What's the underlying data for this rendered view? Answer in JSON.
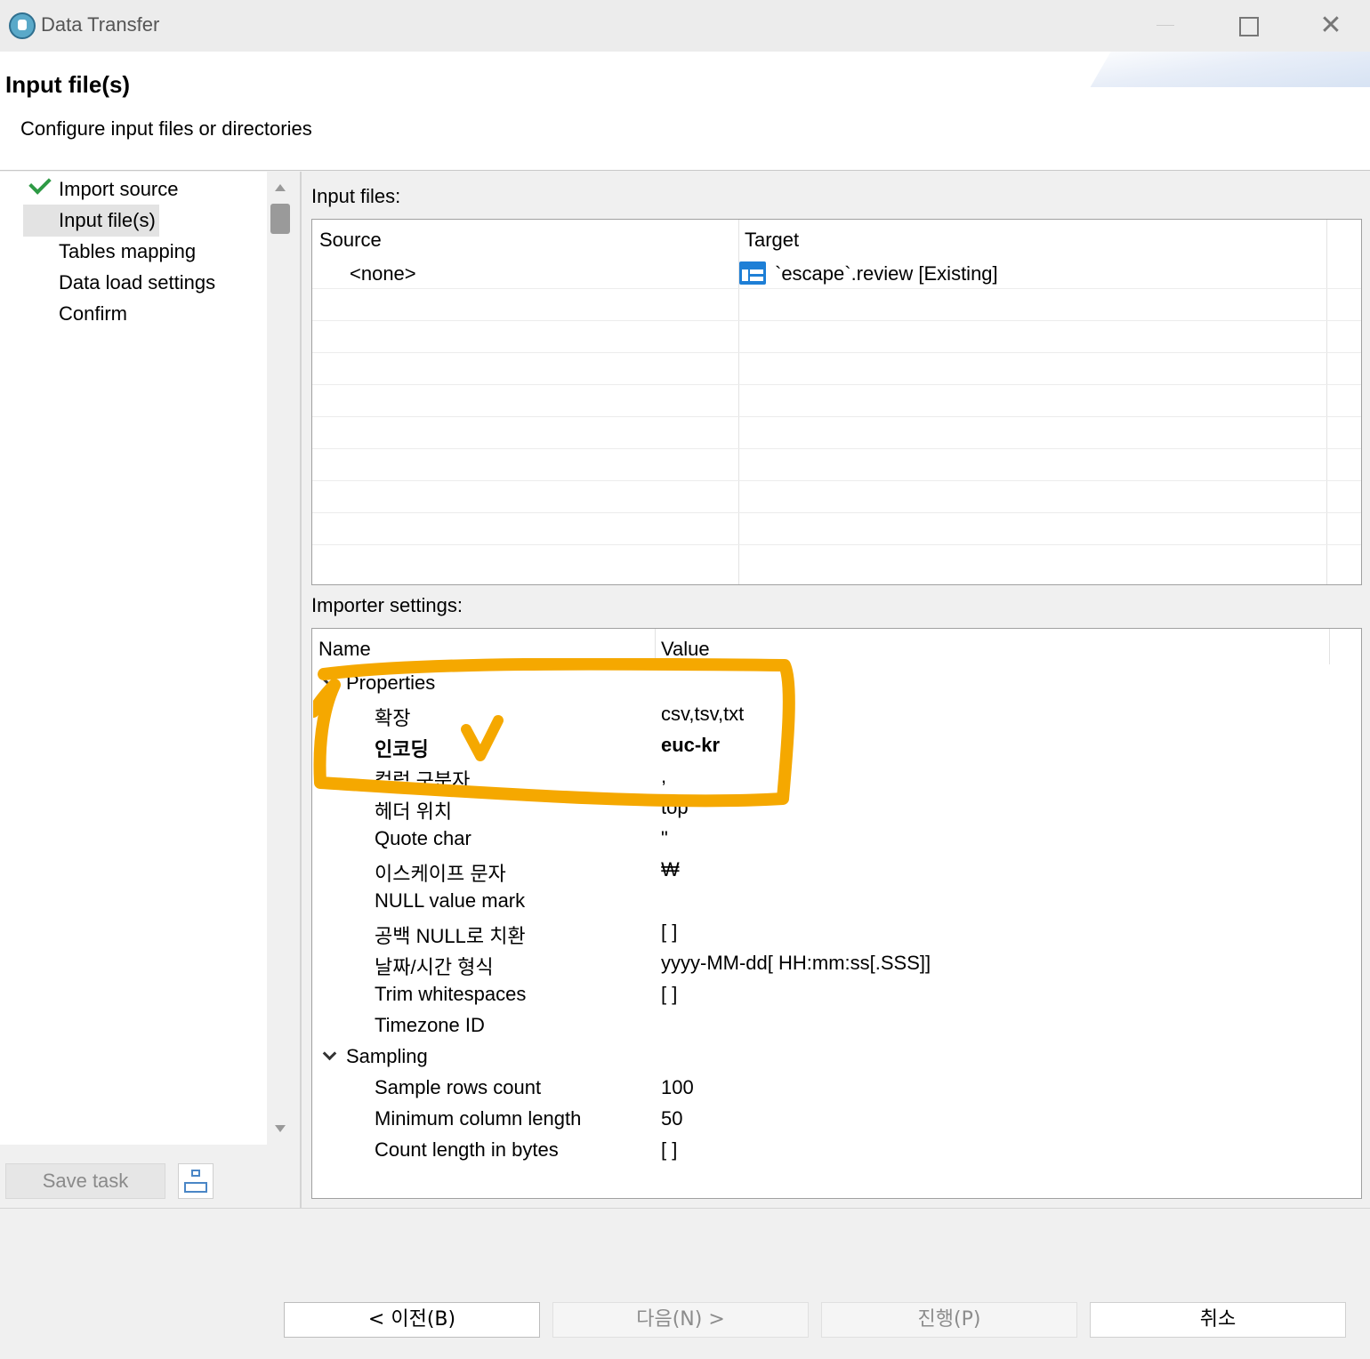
{
  "window": {
    "title": "Data Transfer"
  },
  "header": {
    "title": "Input file(s)",
    "description": "Configure input files or directories"
  },
  "nav": {
    "items": [
      {
        "label": "Import source",
        "done": true
      },
      {
        "label": "Input file(s)",
        "selected": true
      },
      {
        "label": "Tables mapping"
      },
      {
        "label": "Data load settings"
      },
      {
        "label": "Confirm"
      }
    ]
  },
  "input_files": {
    "label": "Input files:",
    "columns": [
      "Source",
      "Target"
    ],
    "rows": [
      {
        "source": "<none>",
        "target": "`escape`.review [Existing]"
      }
    ]
  },
  "importer": {
    "label": "Importer settings:",
    "columns": [
      "Name",
      "Value"
    ],
    "groups": [
      {
        "name": "Properties",
        "items": [
          {
            "name": "확장",
            "value": "csv,tsv,txt"
          },
          {
            "name": "인코딩",
            "value": "euc-kr",
            "bold": true
          },
          {
            "name": "컬럼 구분자",
            "value": ","
          },
          {
            "name": "헤더 위치",
            "value": "top"
          },
          {
            "name": "Quote char",
            "value": "\""
          },
          {
            "name": "이스케이프 문자",
            "value": "₩"
          },
          {
            "name": "NULL value mark",
            "value": ""
          },
          {
            "name": "공백 NULL로 치환",
            "value": "[ ]"
          },
          {
            "name": "날짜/시간 형식",
            "value": "yyyy-MM-dd[ HH:mm:ss[.SSS]]"
          },
          {
            "name": "Trim whitespaces",
            "value": "[ ]"
          },
          {
            "name": "Timezone ID",
            "value": ""
          }
        ]
      },
      {
        "name": "Sampling",
        "items": [
          {
            "name": "Sample rows count",
            "value": "100"
          },
          {
            "name": "Minimum column length",
            "value": "50"
          },
          {
            "name": "Count length in bytes",
            "value": "[ ]"
          }
        ]
      }
    ]
  },
  "buttons": {
    "save_task": "Save task",
    "back": "< 이전(B)",
    "next": "다음(N) >",
    "finish": "진행(P)",
    "cancel": "취소"
  },
  "colors": {
    "highlight": "#f5a800",
    "check": "#2e9a45",
    "table_icon": "#1e7fd6"
  }
}
